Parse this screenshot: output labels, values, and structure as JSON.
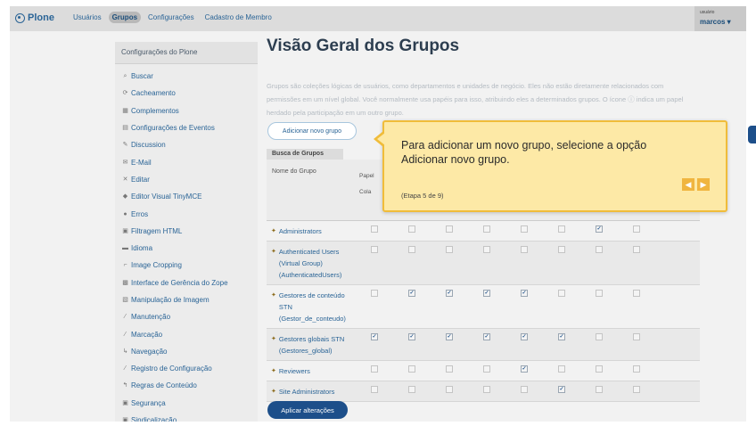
{
  "topbar": {
    "logo": "Plone",
    "nav": [
      "Usuários",
      "Grupos",
      "Configurações",
      "Cadastro de Membro"
    ],
    "active_index": 1,
    "user_label": "usuário",
    "user_name": "marcos ▾"
  },
  "sidebar": {
    "title": "Configurações do Plone",
    "items": [
      {
        "label": "Buscar",
        "icon": "search-icon"
      },
      {
        "label": "Cacheamento",
        "icon": "cache-icon"
      },
      {
        "label": "Complementos",
        "icon": "puzzle-icon"
      },
      {
        "label": "Configurações de Eventos",
        "icon": "calendar-icon"
      },
      {
        "label": "Discussion",
        "icon": "comment-icon"
      },
      {
        "label": "E-Mail",
        "icon": "mail-icon"
      },
      {
        "label": "Editar",
        "icon": "edit-icon"
      },
      {
        "label": "Editor Visual TinyMCE",
        "icon": "editor-icon"
      },
      {
        "label": "Erros",
        "icon": "error-icon"
      },
      {
        "label": "Filtragem HTML",
        "icon": "filter-icon"
      },
      {
        "label": "Idioma",
        "icon": "language-icon"
      },
      {
        "label": "Image Cropping",
        "icon": "crop-icon"
      },
      {
        "label": "Interface de Gerência do Zope",
        "icon": "zope-icon"
      },
      {
        "label": "Manipulação de Imagem",
        "icon": "image-icon"
      },
      {
        "label": "Manutenção",
        "icon": "wrench-icon"
      },
      {
        "label": "Marcação",
        "icon": "markup-icon"
      },
      {
        "label": "Navegação",
        "icon": "navigation-icon"
      },
      {
        "label": "Registro de Configuração",
        "icon": "registry-icon"
      },
      {
        "label": "Regras de Conteúdo",
        "icon": "rules-icon"
      },
      {
        "label": "Segurança",
        "icon": "lock-icon"
      },
      {
        "label": "Sindicalização",
        "icon": "rss-icon"
      }
    ]
  },
  "main": {
    "title": "Visão Geral dos Grupos",
    "description": "Grupos são coleções lógicas de usuários, como departamentos e unidades de negócio. Eles não estão diretamente relacionados com permissões em um nível global. Você normalmente usa papéis para isso, atribuindo eles a determinados grupos. O ícone ⓘ indica um papel herdado pela participação em um outro grupo.",
    "add_button": "Adicionar novo grupo",
    "search_tab": "Busca de Grupos",
    "col_group": "Nome do Grupo",
    "col_roles": "Papel",
    "col_roles2": "Cola",
    "apply_button": "Aplicar alterações"
  },
  "groups": [
    {
      "name": "Administrators",
      "checks": [
        0,
        0,
        0,
        0,
        0,
        0,
        1,
        0
      ]
    },
    {
      "name": "Authenticated Users (Virtual Group) (AuthenticatedUsers)",
      "checks": [
        0,
        0,
        0,
        0,
        0,
        0,
        0,
        0
      ]
    },
    {
      "name": "Gestores de conteúdo STN (Gestor_de_conteudo)",
      "checks": [
        0,
        1,
        1,
        1,
        1,
        0,
        0,
        0
      ]
    },
    {
      "name": "Gestores globais STN (Gestores_global)",
      "checks": [
        1,
        1,
        1,
        1,
        1,
        1,
        0,
        0
      ]
    },
    {
      "name": "Reviewers",
      "checks": [
        0,
        0,
        0,
        0,
        1,
        0,
        0,
        0
      ]
    },
    {
      "name": "Site Administrators",
      "checks": [
        0,
        0,
        0,
        0,
        0,
        1,
        0,
        0
      ]
    }
  ],
  "tour": {
    "text": "Para adicionar um novo grupo, selecione a opção Adicionar novo grupo.",
    "step": "(Etapa 5 de 9)",
    "prev": "◀",
    "next": "▶"
  }
}
